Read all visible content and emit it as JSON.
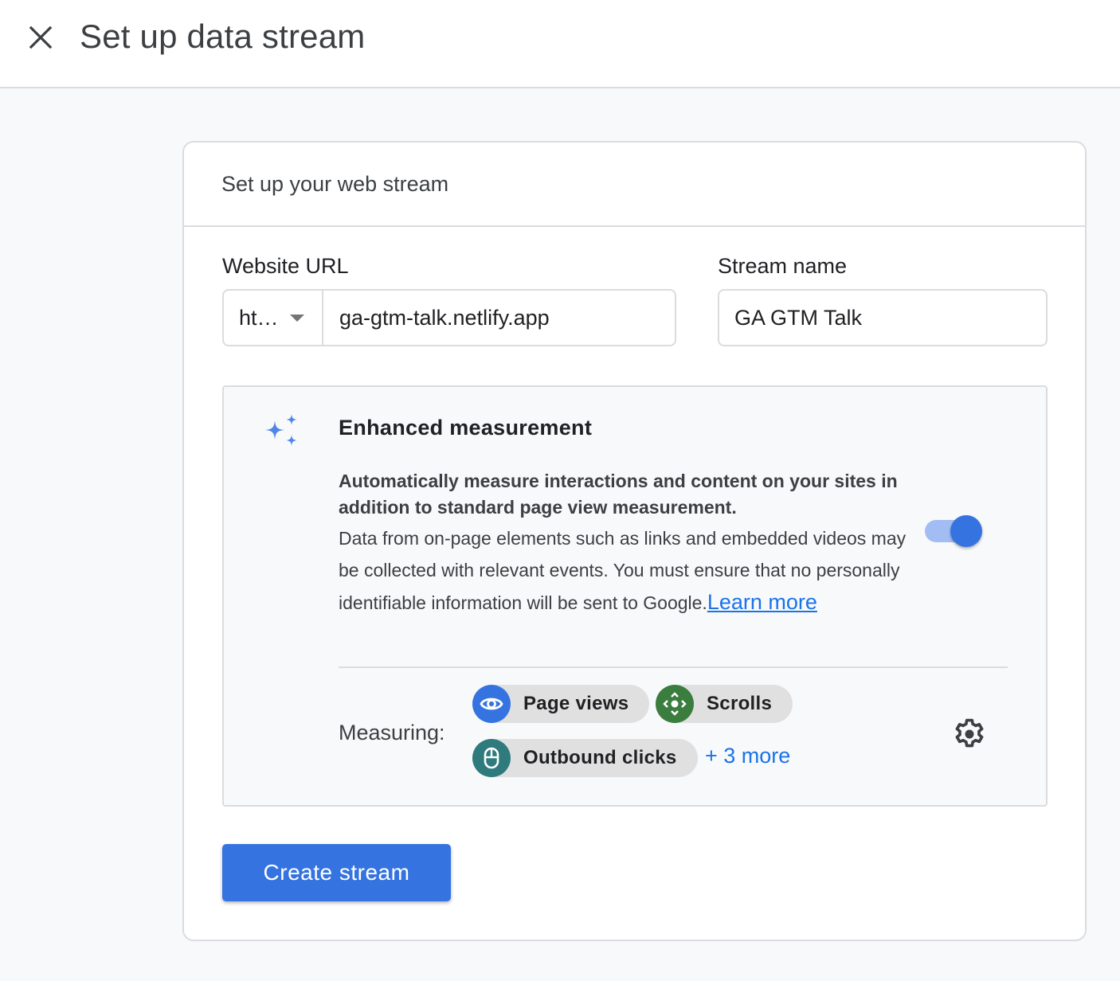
{
  "header": {
    "title": "Set up data stream",
    "close_icon": "close-icon"
  },
  "card": {
    "title": "Set up your web stream",
    "website_url": {
      "label": "Website URL",
      "protocol_value": "ht…",
      "value": "ga-gtm-talk.netlify.app"
    },
    "stream_name": {
      "label": "Stream name",
      "value": "GA GTM Talk"
    },
    "enhanced_measurement": {
      "icon": "sparkle-icon",
      "title": "Enhanced measurement",
      "description_bold": "Automatically measure interactions and content on your sites in addition to standard page view measurement.",
      "description": "Data from on-page elements such as links and embedded videos may be collected with relevant events. You must ensure that no personally identifiable information will be sent to Google.",
      "learn_more_label": "Learn more",
      "enabled": true,
      "measuring_label": "Measuring:",
      "chips": [
        {
          "label": "Page views",
          "icon": "eye-icon",
          "color": "#3574e0"
        },
        {
          "label": "Scrolls",
          "icon": "scroll-icon",
          "color": "#3a7d3e"
        },
        {
          "label": "Outbound clicks",
          "icon": "mouse-icon",
          "color": "#2e7a7d"
        }
      ],
      "more_label": "+ 3 more",
      "settings_icon": "gear-icon"
    },
    "create_button_label": "Create stream"
  },
  "colors": {
    "accent": "#3574e0",
    "link": "#1a73e8",
    "border": "#dadce0",
    "background": "#f8f9fa"
  }
}
